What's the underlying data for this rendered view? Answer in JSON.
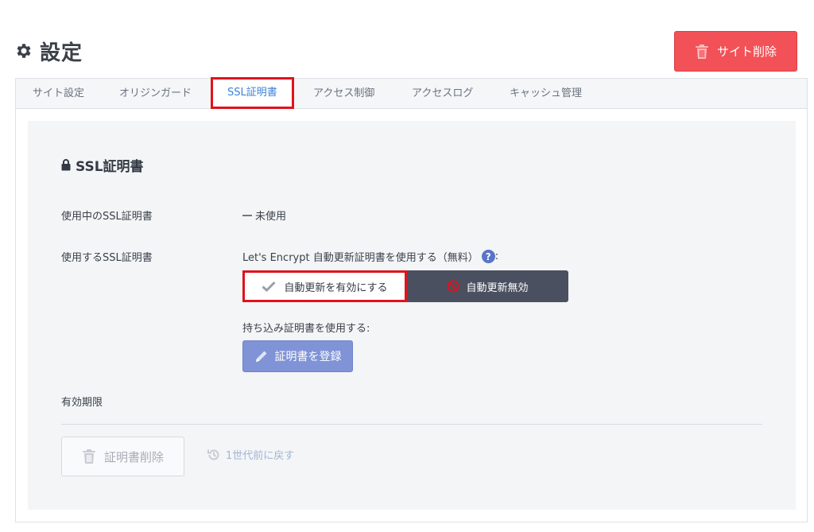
{
  "header": {
    "title": "設定",
    "title_icon": "gear-icon",
    "delete_site_label": "サイト削除",
    "delete_site_icon": "trash-icon"
  },
  "tabs": [
    {
      "label": "サイト設定",
      "active": false
    },
    {
      "label": "オリジンガード",
      "active": false
    },
    {
      "label": "SSL証明書",
      "active": true
    },
    {
      "label": "アクセス制御",
      "active": false
    },
    {
      "label": "アクセスログ",
      "active": false
    },
    {
      "label": "キャッシュ管理",
      "active": false
    }
  ],
  "ssl": {
    "section_title": "SSL証明書",
    "section_icon": "lock-icon",
    "current_cert_label": "使用中のSSL証明書",
    "current_cert_value": "未使用",
    "use_cert_label": "使用するSSL証明書",
    "letsencrypt_text": "Let's Encrypt 自動更新証明書を使用する（無料）",
    "letsencrypt_colon": ":",
    "help_icon": "question-circle-icon",
    "enable_auto_label": "自動更新を有効にする",
    "disable_auto_label": "自動更新無効",
    "byo_text": "持ち込み証明書を使用する:",
    "register_label": "証明書を登録",
    "expiry_label": "有効期限",
    "delete_cert_label": "証明書削除",
    "revert_label": "1世代前に戻す"
  },
  "colors": {
    "danger": "#f25157",
    "primary_tab": "#3b82d8",
    "highlight_border": "#e0121c",
    "toggle_off_bg": "#4a5060",
    "register_bg": "#7f93d6",
    "content_bg": "#f3f5f6"
  }
}
